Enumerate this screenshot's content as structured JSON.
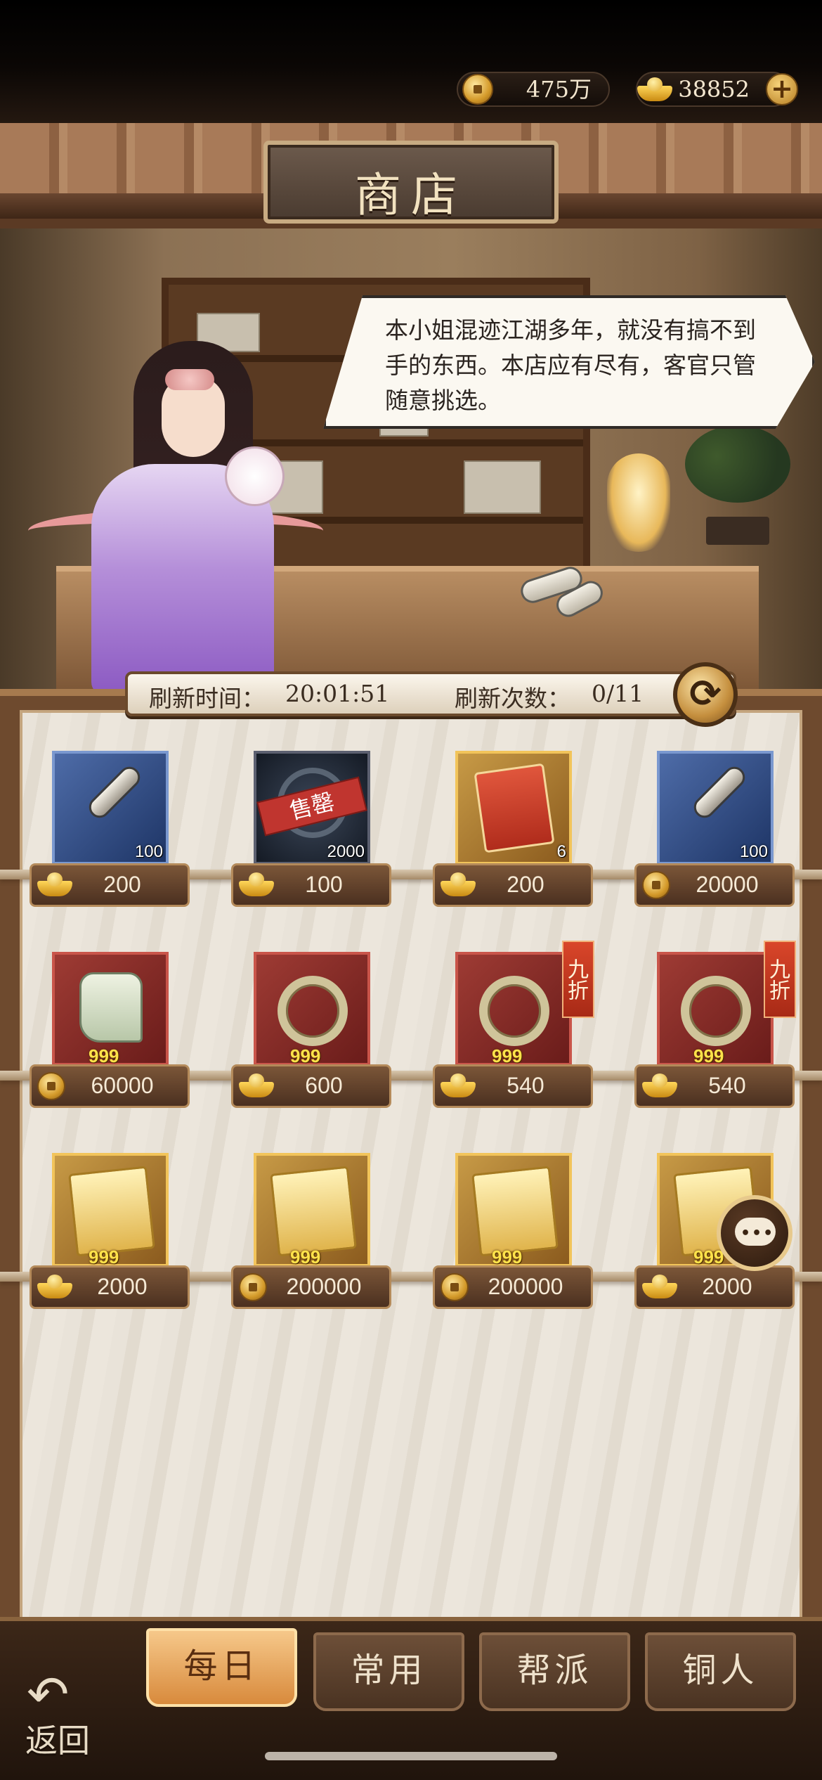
{
  "resources": {
    "copper": {
      "icon": "copper-coin-icon",
      "value": "475万"
    },
    "gold": {
      "icon": "gold-ingot-icon",
      "value": "38852"
    },
    "add_icon": "plus-icon"
  },
  "title": "商店",
  "npc_dialog": "本小姐混迹江湖多年，就没有搞不到手的东西。本店应有尽有，客官只管随意挑选。",
  "refresh": {
    "time_label": "刷新时间：",
    "time_value": "20:01:51",
    "count_label": "刷新次数：",
    "count_value": "0/11"
  },
  "items": [
    {
      "icon": "scroll-icon",
      "frame": "blue",
      "qty": "100",
      "currency": "gold-ingot",
      "price": "200"
    },
    {
      "icon": "sold-out-item-icon",
      "frame": "dark",
      "qty": "2000",
      "badge": "售罄",
      "currency": "gold-ingot",
      "price": "100"
    },
    {
      "icon": "red-envelope-icon",
      "frame": "gold",
      "qty": "6",
      "currency": "gold-ingot",
      "price": "200"
    },
    {
      "icon": "scroll-icon",
      "frame": "blue",
      "qty": "100",
      "currency": "copper-coin",
      "price": "20000"
    },
    {
      "icon": "boots-icon",
      "frame": "red",
      "qty": "999",
      "currency": "copper-coin",
      "price": "60000"
    },
    {
      "icon": "jade-ring-icon",
      "frame": "red",
      "qty": "999",
      "currency": "gold-ingot",
      "price": "600"
    },
    {
      "icon": "belt-icon",
      "frame": "red",
      "qty": "999",
      "discount": "九折",
      "currency": "gold-ingot",
      "price": "540"
    },
    {
      "icon": "jade-ring-icon",
      "frame": "red",
      "qty": "999",
      "discount": "九折",
      "currency": "gold-ingot",
      "price": "540"
    },
    {
      "icon": "martial-manual-icon",
      "frame": "gold",
      "qty": "999",
      "currency": "gold-ingot",
      "price": "2000"
    },
    {
      "icon": "martial-manual-icon",
      "frame": "gold",
      "qty": "999",
      "currency": "copper-coin",
      "price": "200000"
    },
    {
      "icon": "martial-manual-icon",
      "frame": "gold",
      "qty": "999",
      "currency": "copper-coin",
      "price": "200000"
    },
    {
      "icon": "martial-manual-icon",
      "frame": "gold",
      "qty": "999",
      "currency": "gold-ingot",
      "price": "2000"
    }
  ],
  "tabs": [
    {
      "label": "每日",
      "active": true
    },
    {
      "label": "常用",
      "active": false
    },
    {
      "label": "帮派",
      "active": false
    },
    {
      "label": "铜人",
      "active": false
    }
  ],
  "back_label": "返回",
  "colors": {
    "active_tab": "#d88a3c",
    "discount": "#d9462a",
    "soldout": "#c0352f"
  }
}
